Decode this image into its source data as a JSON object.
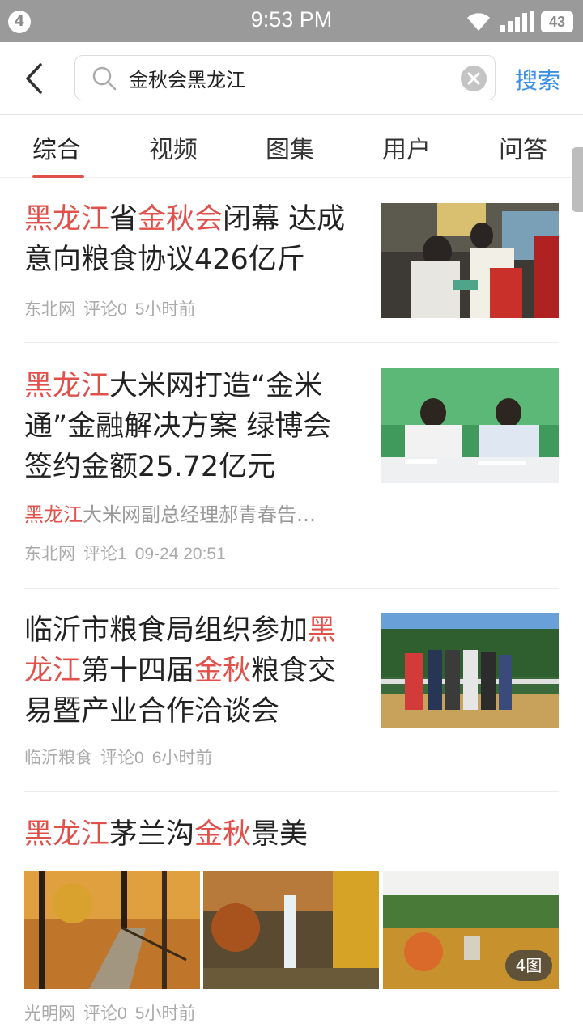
{
  "status_bar": {
    "notification_count": "4",
    "time": "9:53 PM",
    "battery_level": "43"
  },
  "search": {
    "query": "金秋会黑龙江",
    "button_label": "搜索"
  },
  "tabs": [
    {
      "label": "综合",
      "active": true
    },
    {
      "label": "视频",
      "active": false
    },
    {
      "label": "图集",
      "active": false
    },
    {
      "label": "用户",
      "active": false
    },
    {
      "label": "问答",
      "active": false
    }
  ],
  "articles": [
    {
      "title_parts": [
        {
          "text": "黑龙江",
          "hl": true
        },
        {
          "text": "省",
          "hl": false
        },
        {
          "text": "金秋会",
          "hl": true
        },
        {
          "text": "闭幕 达成意向粮食协议426亿斤",
          "hl": false
        }
      ],
      "source": "东北网",
      "comments": "评论0",
      "time": "5小时前"
    },
    {
      "title_parts": [
        {
          "text": "黑龙江",
          "hl": true
        },
        {
          "text": "大米网打造“金米通”金融解决方案 绿博会签约金额25.72亿元",
          "hl": false
        }
      ],
      "abstract_parts": [
        {
          "text": "黑龙江",
          "hl": true
        },
        {
          "text": "大米网副总经理郝青春告…",
          "hl": false
        }
      ],
      "source": "东北网",
      "comments": "评论1",
      "time": "09-24 20:51"
    },
    {
      "title_parts": [
        {
          "text": "临沂市粮食局组织参加",
          "hl": false
        },
        {
          "text": "黑龙江",
          "hl": true
        },
        {
          "text": "第十四届",
          "hl": false
        },
        {
          "text": "金秋",
          "hl": true
        },
        {
          "text": "粮食交易暨产业合作洽谈会",
          "hl": false
        }
      ],
      "source": "临沂粮食",
      "comments": "评论0",
      "time": "6小时前"
    },
    {
      "title_parts": [
        {
          "text": "黑龙江",
          "hl": true
        },
        {
          "text": "茅兰沟",
          "hl": false
        },
        {
          "text": "金秋",
          "hl": true
        },
        {
          "text": "景美",
          "hl": false
        }
      ],
      "image_count": "4图",
      "source": "光明网",
      "comments": "评论0",
      "time": "5小时前"
    }
  ],
  "colors": {
    "highlight": "#e0514b",
    "accent": "#3a8ee6",
    "meta": "#aaaaaa"
  }
}
